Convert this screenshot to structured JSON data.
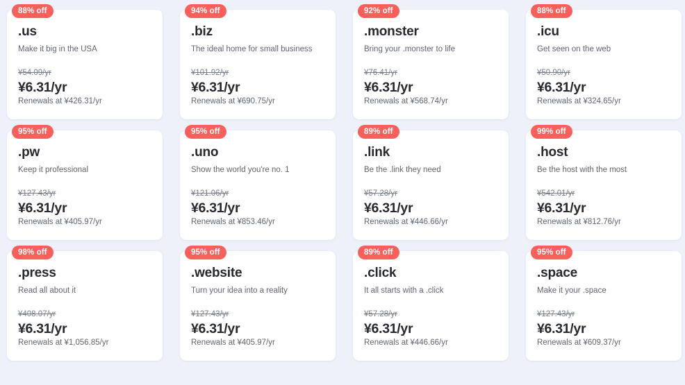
{
  "page": {
    "background_color": "#eef1f9",
    "badge_color": "#f9605b",
    "card_color": "#ffffff"
  },
  "cards": [
    {
      "badge": "88% off",
      "name": ".us",
      "tagline": "Make it big in the USA",
      "old_price": "¥54.09/yr",
      "sale_price": "¥6.31/yr",
      "renewal": "Renewals at ¥426.31/yr"
    },
    {
      "badge": "94% off",
      "name": ".biz",
      "tagline": "The ideal home for small business",
      "old_price": "¥101.92/yr",
      "sale_price": "¥6.31/yr",
      "renewal": "Renewals at ¥690.75/yr"
    },
    {
      "badge": "92% off",
      "name": ".monster",
      "tagline": "Bring your .monster to life",
      "old_price": "¥76.41/yr",
      "sale_price": "¥6.31/yr",
      "renewal": "Renewals at ¥568.74/yr"
    },
    {
      "badge": "88% off",
      "name": ".icu",
      "tagline": "Get seen on the web",
      "old_price": "¥50.90/yr",
      "sale_price": "¥6.31/yr",
      "renewal": "Renewals at ¥324.65/yr"
    },
    {
      "badge": "95% off",
      "name": ".pw",
      "tagline": "Keep it professional",
      "old_price": "¥127.43/yr",
      "sale_price": "¥6.31/yr",
      "renewal": "Renewals at ¥405.97/yr"
    },
    {
      "badge": "95% off",
      "name": ".uno",
      "tagline": "Show the world you're no. 1",
      "old_price": "¥121.06/yr",
      "sale_price": "¥6.31/yr",
      "renewal": "Renewals at ¥853.46/yr"
    },
    {
      "badge": "89% off",
      "name": ".link",
      "tagline": "Be the .link they need",
      "old_price": "¥57.28/yr",
      "sale_price": "¥6.31/yr",
      "renewal": "Renewals at ¥446.66/yr"
    },
    {
      "badge": "99% off",
      "name": ".host",
      "tagline": "Be the host with the most",
      "old_price": "¥542.01/yr",
      "sale_price": "¥6.31/yr",
      "renewal": "Renewals at ¥812.76/yr"
    },
    {
      "badge": "98% off",
      "name": ".press",
      "tagline": "Read all about it",
      "old_price": "¥408.07/yr",
      "sale_price": "¥6.31/yr",
      "renewal": "Renewals at ¥1,056.85/yr"
    },
    {
      "badge": "95% off",
      "name": ".website",
      "tagline": "Turn your idea into a reality",
      "old_price": "¥127.43/yr",
      "sale_price": "¥6.31/yr",
      "renewal": "Renewals at ¥405.97/yr"
    },
    {
      "badge": "89% off",
      "name": ".click",
      "tagline": "It all starts with a .click",
      "old_price": "¥57.28/yr",
      "sale_price": "¥6.31/yr",
      "renewal": "Renewals at ¥446.66/yr"
    },
    {
      "badge": "95% off",
      "name": ".space",
      "tagline": "Make it your .space",
      "old_price": "¥127.43/yr",
      "sale_price": "¥6.31/yr",
      "renewal": "Renewals at ¥609.37/yr"
    }
  ]
}
